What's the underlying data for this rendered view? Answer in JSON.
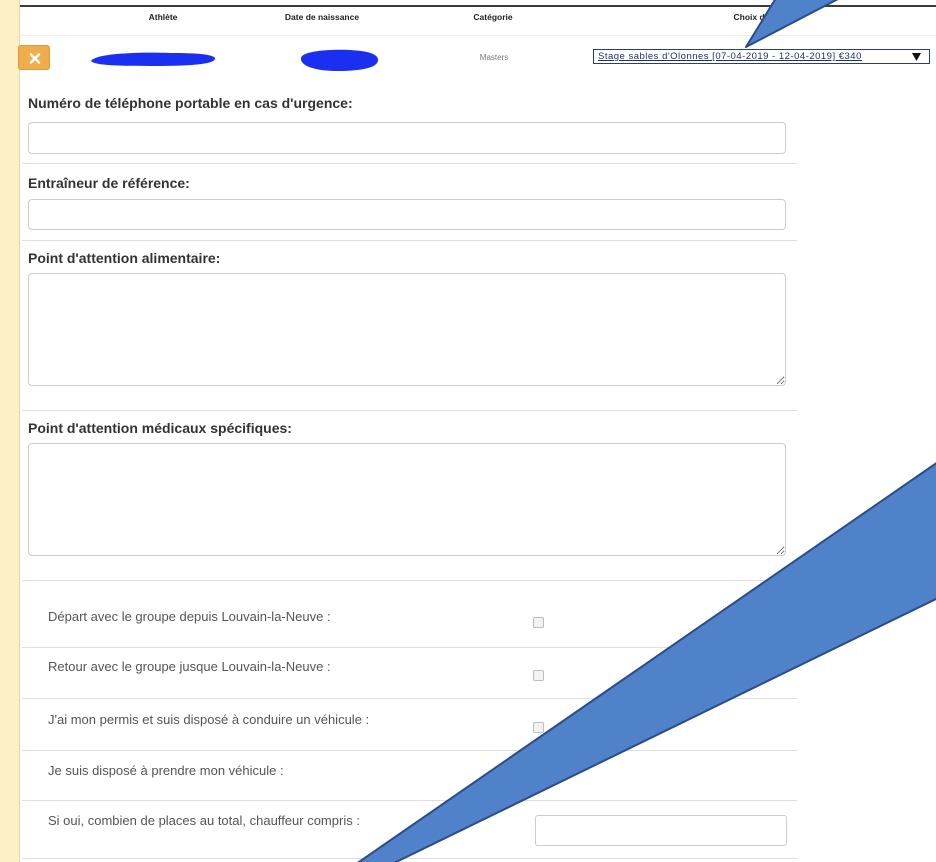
{
  "header": {
    "columns": [
      "Athlète",
      "Date de naissance",
      "Catégorie",
      "Choix du stage"
    ]
  },
  "registration_row": {
    "remove_icon": "close-icon",
    "category": "Masters",
    "stage_select": {
      "selected": "Stage sables d'Olonnes [07-04-2019 - 12-04-2019] €340",
      "icon": "chevron-down-icon"
    }
  },
  "form": {
    "emergency_phone": {
      "label": "Numéro de téléphone portable en cas d'urgence:",
      "value": ""
    },
    "reference_coach": {
      "label": "Entraîneur de référence:",
      "value": ""
    },
    "dietary_notes": {
      "label": "Point d'attention alimentaire:",
      "value": ""
    },
    "medical_notes": {
      "label": "Point d'attention médicaux spécifiques:",
      "value": ""
    }
  },
  "transport": {
    "options": [
      {
        "label": "Départ avec le groupe depuis Louvain-la-Neuve :",
        "checked": false
      },
      {
        "label": "Retour avec le groupe jusque Louvain-la-Neuve :",
        "checked": false
      },
      {
        "label": "J'ai mon permis et suis disposé à conduire un véhicule :",
        "checked": false
      },
      {
        "label": "Je suis disposé à prendre mon véhicule :",
        "checked": false
      }
    ],
    "seats": {
      "label": "Si oui, combien de places au total, chauffeur compris :",
      "value": ""
    }
  },
  "colors": {
    "sidebar": "#fbf0c6",
    "accent": "#f0ad4e",
    "redaction": "#1b2ff0",
    "arrow_fill": "#4f82c9",
    "arrow_stroke": "#2b4c88"
  }
}
